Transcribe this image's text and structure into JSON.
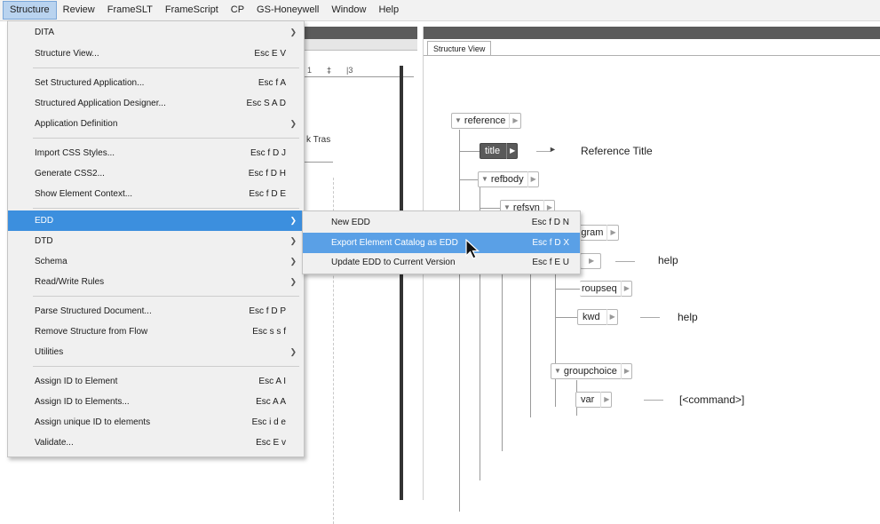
{
  "menubar": {
    "items": [
      "Structure",
      "Review",
      "FrameSLT",
      "FrameScript",
      "CP",
      "GS-Honeywell",
      "Window",
      "Help"
    ]
  },
  "structure_menu": {
    "items": [
      {
        "label": "DITA",
        "shortcut": "",
        "submenu": true
      },
      {
        "label": "Structure View...",
        "shortcut": "Esc E V",
        "submenu": false
      },
      {
        "label": "Set Structured Application...",
        "shortcut": "Esc f A",
        "submenu": false
      },
      {
        "label": "Structured Application Designer...",
        "shortcut": "Esc S A D",
        "submenu": false
      },
      {
        "label": "Application Definition",
        "shortcut": "",
        "submenu": true
      },
      {
        "label": "Import CSS Styles...",
        "shortcut": "Esc f D J",
        "submenu": false
      },
      {
        "label": "Generate CSS2...",
        "shortcut": "Esc f D H",
        "submenu": false
      },
      {
        "label": "Show Element Context...",
        "shortcut": "Esc f D E",
        "submenu": false
      },
      {
        "label": "EDD",
        "shortcut": "",
        "submenu": true
      },
      {
        "label": "DTD",
        "shortcut": "",
        "submenu": true
      },
      {
        "label": "Schema",
        "shortcut": "",
        "submenu": true
      },
      {
        "label": "Read/Write Rules",
        "shortcut": "",
        "submenu": true
      },
      {
        "label": "Parse Structured Document...",
        "shortcut": "Esc f D P",
        "submenu": false
      },
      {
        "label": "Remove Structure from Flow",
        "shortcut": "Esc s s f",
        "submenu": false
      },
      {
        "label": "Utilities",
        "shortcut": "",
        "submenu": true
      },
      {
        "label": "Assign ID to Element",
        "shortcut": "Esc A I",
        "submenu": false
      },
      {
        "label": "Assign ID to Elements...",
        "shortcut": "Esc A A",
        "submenu": false
      },
      {
        "label": "Assign unique ID to elements",
        "shortcut": "Esc i d e",
        "submenu": false
      },
      {
        "label": "Validate...",
        "shortcut": "Esc E v",
        "submenu": false
      }
    ]
  },
  "edd_submenu": {
    "items": [
      {
        "label": "New EDD",
        "shortcut": "Esc f D N"
      },
      {
        "label": "Export Element Catalog as EDD",
        "shortcut": "Esc f D X"
      },
      {
        "label": "Update EDD to Current Version",
        "shortcut": "Esc f E U"
      }
    ]
  },
  "document": {
    "ruler_marks": [
      "1",
      "‡",
      "|3"
    ],
    "text_fragment": "k Tras"
  },
  "structure_view": {
    "tab_label": "Structure View",
    "nodes": {
      "reference": "reference",
      "title": "title",
      "refbody": "refbody",
      "refsyn": "refsyn",
      "syntaxdiagram": "syntaxdiagram",
      "hidden1": "",
      "groupseq": "roupseq",
      "kwd": "kwd",
      "groupchoice": "groupchoice",
      "var": "var"
    },
    "attributes": {
      "title_text": "Reference Title",
      "help1": "help",
      "help2": "help",
      "var_text": "[<command>]"
    }
  },
  "colors": {
    "menu_highlight": "#3c8fde",
    "submenu_highlight": "#5aa0e6",
    "menu_bg": "#f0f0f0"
  }
}
